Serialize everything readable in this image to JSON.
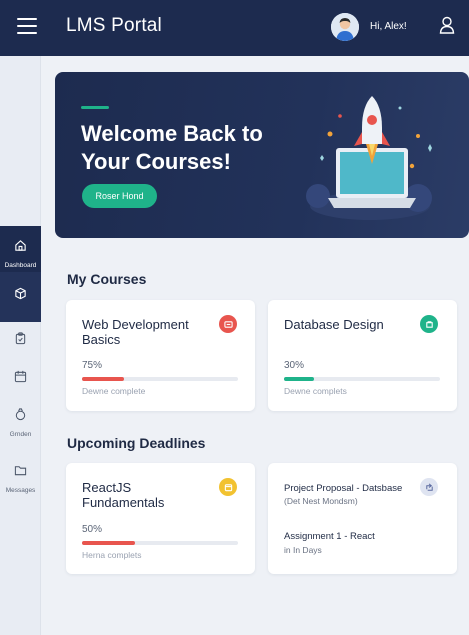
{
  "header": {
    "title": "LMS Portal",
    "greeting": "Hi, Alex!"
  },
  "sidebar": {
    "items": [
      {
        "label": "Dashboard",
        "icon": "home-icon"
      },
      {
        "label": "",
        "icon": "box-icon"
      },
      {
        "label": "",
        "icon": "clipboard-icon"
      },
      {
        "label": "",
        "icon": "calendar-icon"
      },
      {
        "label": "Grnden",
        "icon": "badge-icon"
      },
      {
        "label": "Messages",
        "icon": "folder-icon"
      }
    ]
  },
  "hero": {
    "title": "Welcome Back to Your Courses!",
    "button": "Roser Hond"
  },
  "my_courses": {
    "title": "My Courses",
    "cards": [
      {
        "title": "Web Development Basics",
        "progress": "75%",
        "progress_value": 0.27,
        "status": "Dewne complete",
        "accent": "#e8554e"
      },
      {
        "title": "Database Design",
        "progress": "30%",
        "progress_value": 0.19,
        "status": "Dewne complets",
        "accent": "#1fb38a"
      }
    ]
  },
  "deadlines": {
    "title": "Upcoming Deadlines",
    "card1": {
      "title": "ReactJS Fundamentals",
      "progress": "50%",
      "progress_value": 0.34,
      "status": "Herna complets",
      "accent": "#f2c230"
    },
    "card2": {
      "item1": "Project Proposal - Datsbase",
      "item1_sub": "(Det Nest Mondsm)",
      "item2": "Assignment 1 - React",
      "item2_sub": "in In Days",
      "accent": "#9aa6c9"
    }
  },
  "colors": {
    "navy": "#1d2b4f",
    "green": "#1fb38a",
    "red": "#e8554e",
    "yellow": "#f2c230"
  }
}
